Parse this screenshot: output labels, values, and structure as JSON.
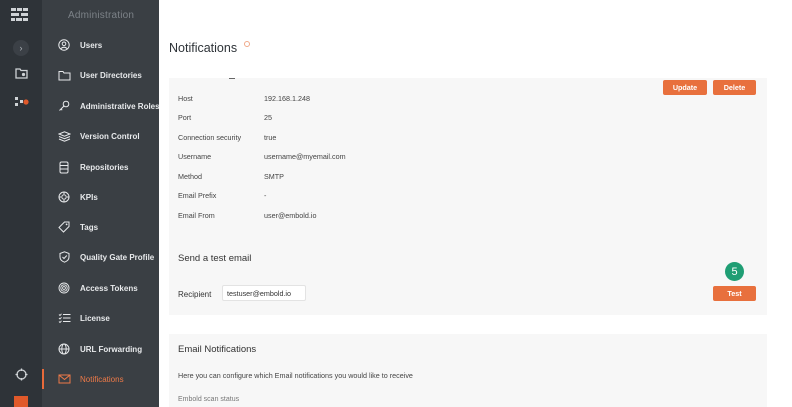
{
  "sidebar": {
    "title": "Administration",
    "items": [
      {
        "label": "Users",
        "icon": "user-icon"
      },
      {
        "label": "User Directories",
        "icon": "folder-icon"
      },
      {
        "label": "Administrative Roles",
        "icon": "key-icon"
      },
      {
        "label": "Version Control",
        "icon": "version-control-icon"
      },
      {
        "label": "Repositories",
        "icon": "repository-icon"
      },
      {
        "label": "KPIs",
        "icon": "kpi-icon"
      },
      {
        "label": "Tags",
        "icon": "tag-icon"
      },
      {
        "label": "Quality Gate Profile",
        "icon": "shield-icon"
      },
      {
        "label": "Access Tokens",
        "icon": "fingerprint-icon"
      },
      {
        "label": "License",
        "icon": "license-icon"
      },
      {
        "label": "URL Forwarding",
        "icon": "globe-icon"
      },
      {
        "label": "Notifications",
        "icon": "mail-icon",
        "active": true
      }
    ]
  },
  "main": {
    "title": "Notifications",
    "smtp": {
      "update_label": "Update",
      "delete_label": "Delete",
      "fields": [
        {
          "key": "Host",
          "value": "192.168.1.248"
        },
        {
          "key": "Port",
          "value": "25"
        },
        {
          "key": "Connection security",
          "value": "true"
        },
        {
          "key": "Username",
          "value": "username@myemail.com"
        },
        {
          "key": "Method",
          "value": "SMTP"
        },
        {
          "key": "Email Prefix",
          "value": "-"
        },
        {
          "key": "Email From",
          "value": "user@embold.io"
        }
      ]
    },
    "test_email": {
      "heading": "Send a test email",
      "recipient_label": "Recipient",
      "recipient_value": "testuser@embold.io",
      "test_label": "Test"
    },
    "email_notifications": {
      "heading": "Email Notifications",
      "description": "Here you can configure which Email notifications you would like to receive",
      "partial_item": "Embold scan status"
    }
  },
  "annotation": {
    "step": "5"
  },
  "colors": {
    "accent": "#e8703d",
    "sidebar_bg": "#3a3f44",
    "rail_bg": "#2e3338",
    "card_bg": "#f7f7f7",
    "badge": "#1f9e74"
  }
}
